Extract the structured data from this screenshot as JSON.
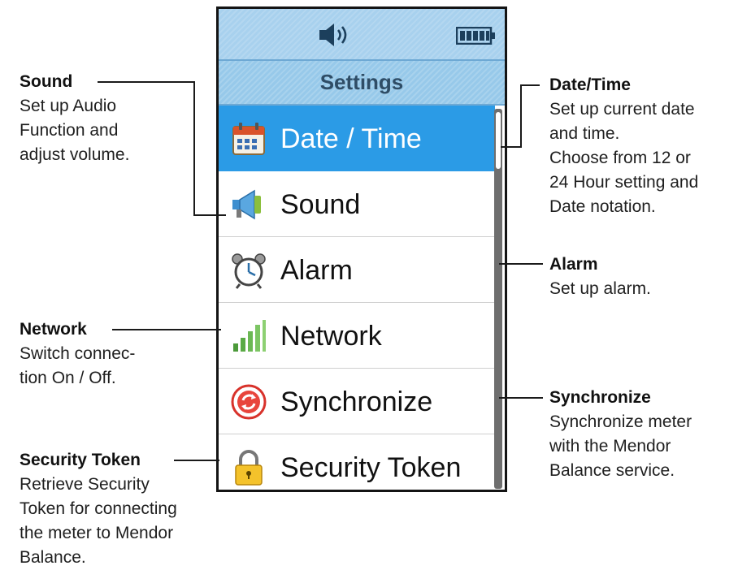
{
  "phone": {
    "status_icons": {
      "speaker": "speaker-icon",
      "battery": "battery-icon"
    },
    "title": "Settings",
    "menu": [
      {
        "label": "Date / Time",
        "icon": "calendar-icon",
        "selected": true
      },
      {
        "label": "Sound",
        "icon": "megaphone-icon",
        "selected": false
      },
      {
        "label": "Alarm",
        "icon": "alarm-clock-icon",
        "selected": false
      },
      {
        "label": "Network",
        "icon": "signal-bars-icon",
        "selected": false
      },
      {
        "label": "Synchronize",
        "icon": "sync-icon",
        "selected": false
      },
      {
        "label": "Security Token",
        "icon": "padlock-icon",
        "selected": false
      }
    ]
  },
  "callouts": {
    "sound": {
      "title": "Sound",
      "desc": "Set up Audio\nFunction and\nadjust volume."
    },
    "network": {
      "title": "Network",
      "desc": "Switch connec-\ntion On / Off."
    },
    "security": {
      "title": "Security Token",
      "desc": "Retrieve Security\nToken for connecting\nthe meter to Mendor\nBalance."
    },
    "datetime": {
      "title": "Date/Time",
      "desc": "Set up current date\nand time.\nChoose from 12 or\n24 Hour setting and\nDate notation."
    },
    "alarm": {
      "title": "Alarm",
      "desc": "Set up alarm."
    },
    "sync": {
      "title": "Synchronize",
      "desc": "Synchronize meter\nwith the Mendor\nBalance service."
    }
  },
  "colors": {
    "accent": "#2b9be6",
    "statusbar": "#a8d1ee",
    "titlebar": "#97c9ea",
    "title_text": "#2f4d66"
  }
}
